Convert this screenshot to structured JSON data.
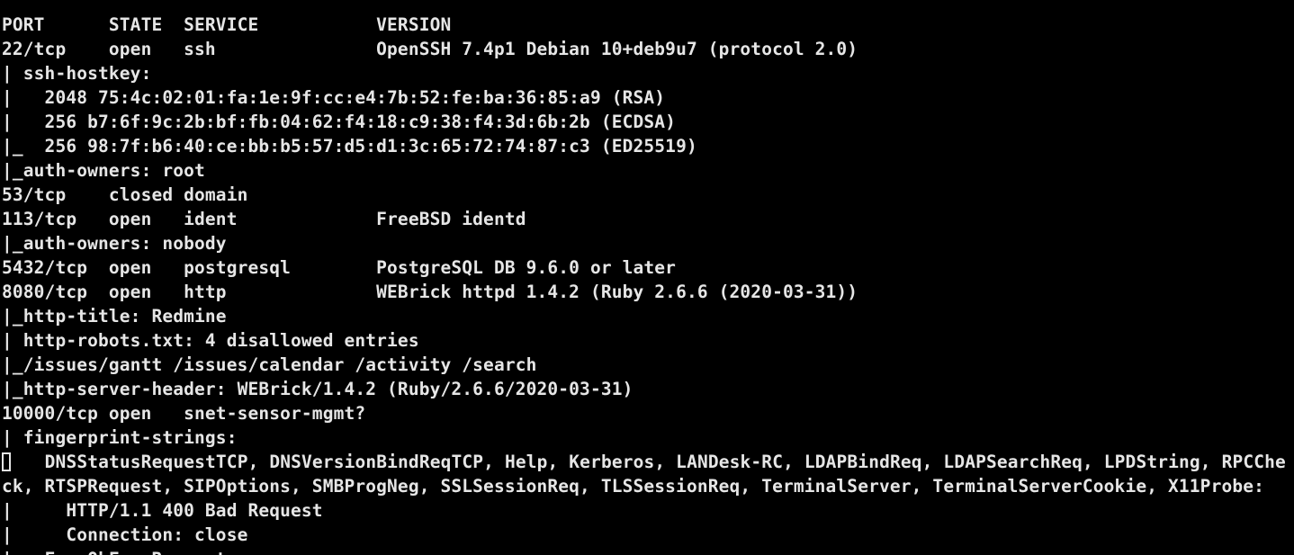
{
  "terminal": {
    "lines": [
      "",
      "PORT      STATE  SERVICE           VERSION",
      "22/tcp    open   ssh               OpenSSH 7.4p1 Debian 10+deb9u7 (protocol 2.0)",
      "| ssh-hostkey:",
      "|   2048 75:4c:02:01:fa:1e:9f:cc:e4:7b:52:fe:ba:36:85:a9 (RSA)",
      "|   256 b7:6f:9c:2b:bf:fb:04:62:f4:18:c9:38:f4:3d:6b:2b (ECDSA)",
      "|_  256 98:7f:b6:40:ce:bb:b5:57:d5:d1:3c:65:72:74:87:c3 (ED25519)",
      "|_auth-owners: root",
      "53/tcp    closed domain",
      "113/tcp   open   ident             FreeBSD identd",
      "|_auth-owners: nobody",
      "5432/tcp  open   postgresql        PostgreSQL DB 9.6.0 or later",
      "8080/tcp  open   http              WEBrick httpd 1.4.2 (Ruby 2.6.6 (2020-03-31))",
      "|_http-title: Redmine",
      "| http-robots.txt: 4 disallowed entries",
      "|_/issues/gantt /issues/calendar /activity /search",
      "|_http-server-header: WEBrick/1.4.2 (Ruby/2.6.6/2020-03-31)",
      "10000/tcp open   snet-sensor-mgmt?",
      "| fingerprint-strings:",
      "   DNSStatusRequestTCP, DNSVersionBindReqTCP, Help, Kerberos, LANDesk-RC, LDAPBindReq, LDAPSearchReq, LPDString, RPCChe",
      "ck, RTSPRequest, SIPOptions, SMBProgNeg, SSLSessionReq, TLSSessionReq, TerminalServer, TerminalServerCookie, X11Probe:",
      "|     HTTP/1.1 400 Bad Request",
      "|     Connection: close",
      "|   FourOhFourRequest:"
    ]
  }
}
